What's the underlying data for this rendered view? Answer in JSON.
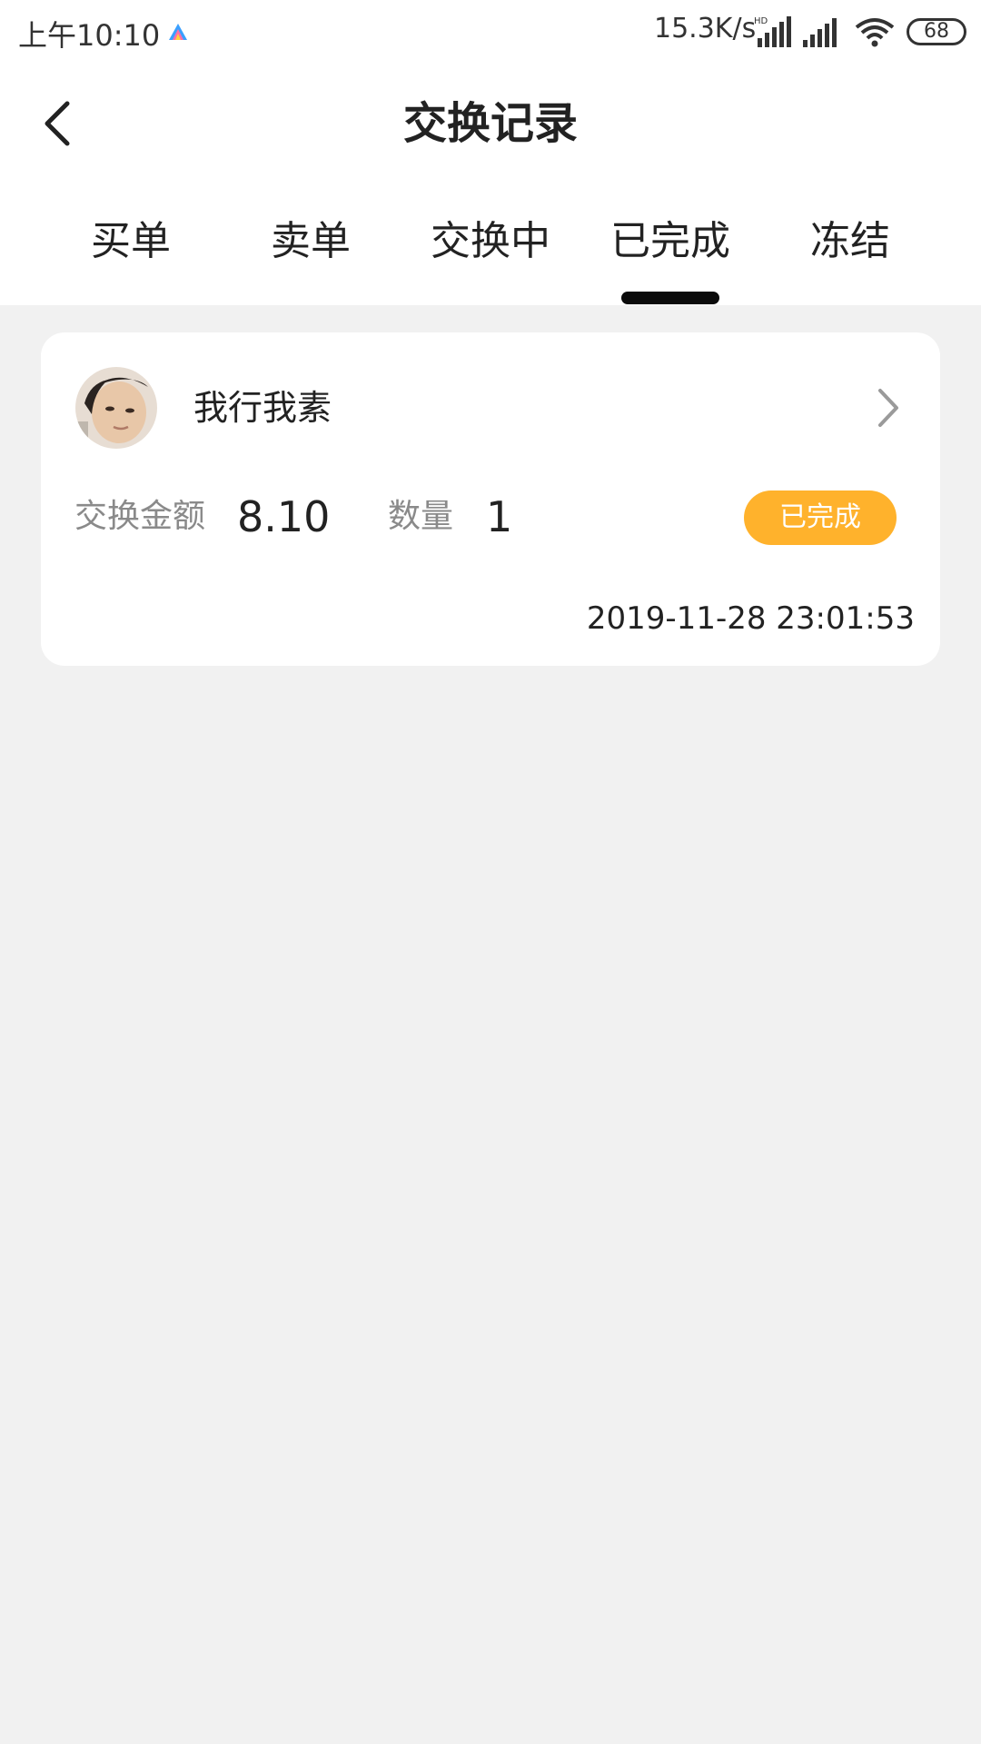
{
  "status_bar": {
    "time": "上午10:10",
    "network_speed": "15.3K/s",
    "battery": "68",
    "signal_label": "HD",
    "icons": [
      "app-icon",
      "signal-icon",
      "signal-icon",
      "wifi-icon",
      "battery-icon"
    ]
  },
  "header": {
    "title": "交换记录",
    "back_icon": "chevron-left-icon"
  },
  "tabs": [
    {
      "label": "买单",
      "active": false
    },
    {
      "label": "卖单",
      "active": false
    },
    {
      "label": "交换中",
      "active": false
    },
    {
      "label": "已完成",
      "active": true
    },
    {
      "label": "冻结",
      "active": false
    }
  ],
  "record": {
    "name": "我行我素",
    "amount_label": "交换金额",
    "amount": "8.10",
    "quantity_label": "数量",
    "quantity": "1",
    "status": "已完成",
    "timestamp": "2019-11-28 23:01:53"
  },
  "colors": {
    "background": "#f1f1f1",
    "card": "#ffffff",
    "accent": "#ffb22c",
    "tab_indicator": "#0b0b0b"
  }
}
